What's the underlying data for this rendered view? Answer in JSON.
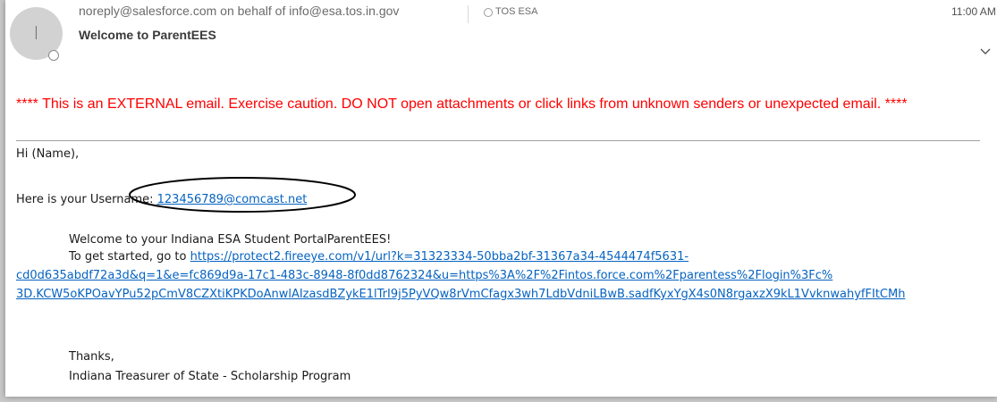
{
  "header": {
    "avatar_initial": "I",
    "from": "noreply@salesforce.com on behalf of info@esa.tos.in.gov",
    "to": "TOS ESA",
    "time": "11:00 AM",
    "subject": "Welcome to ParentEES"
  },
  "body": {
    "warning": "**** This is an EXTERNAL email. Exercise caution. DO NOT open attachments or click links from unknown senders or unexpected email. ****",
    "greeting": "Hi (Name),",
    "username_label": "Here is your Username:",
    "username_link": "123456789@comcast.net",
    "welcome": "Welcome to your Indiana ESA Student PortalParentEES!",
    "get_started": "To get started, go to",
    "url_line1": "https://protect2.fireeye.com/v1/url?k=31323334-50bba2bf-31367a34-4544474f5631-",
    "url_line2": "cd0d635abdf72a3d&q=1&e=fc869d9a-17c1-483c-8948-8f0dd8762324&u=https%3A%2F%2Fintos.force.com%2Fparentess%2Flogin%3Fc%",
    "url_line3": "3D.KCW5oKPOavYPu52pCmV8CZXtiKPKDoAnwlAIzasdBZykE1lTrI9j5PyVQw8rVmCfagx3wh7LdbVdniLBwB.sadfKyxYgX4s0N8rgaxzX9kL1VvknwahyfFItCMh",
    "thanks": "Thanks,",
    "signature": "Indiana Treasurer of State - Scholarship Program"
  },
  "colors": {
    "warning": "#ff0000",
    "link": "#0563c1",
    "annotation": "#000000"
  },
  "icons": {
    "presence": "presence-status-icon",
    "recipient": "recipient-status-icon",
    "expand": "chevron-down-icon"
  }
}
